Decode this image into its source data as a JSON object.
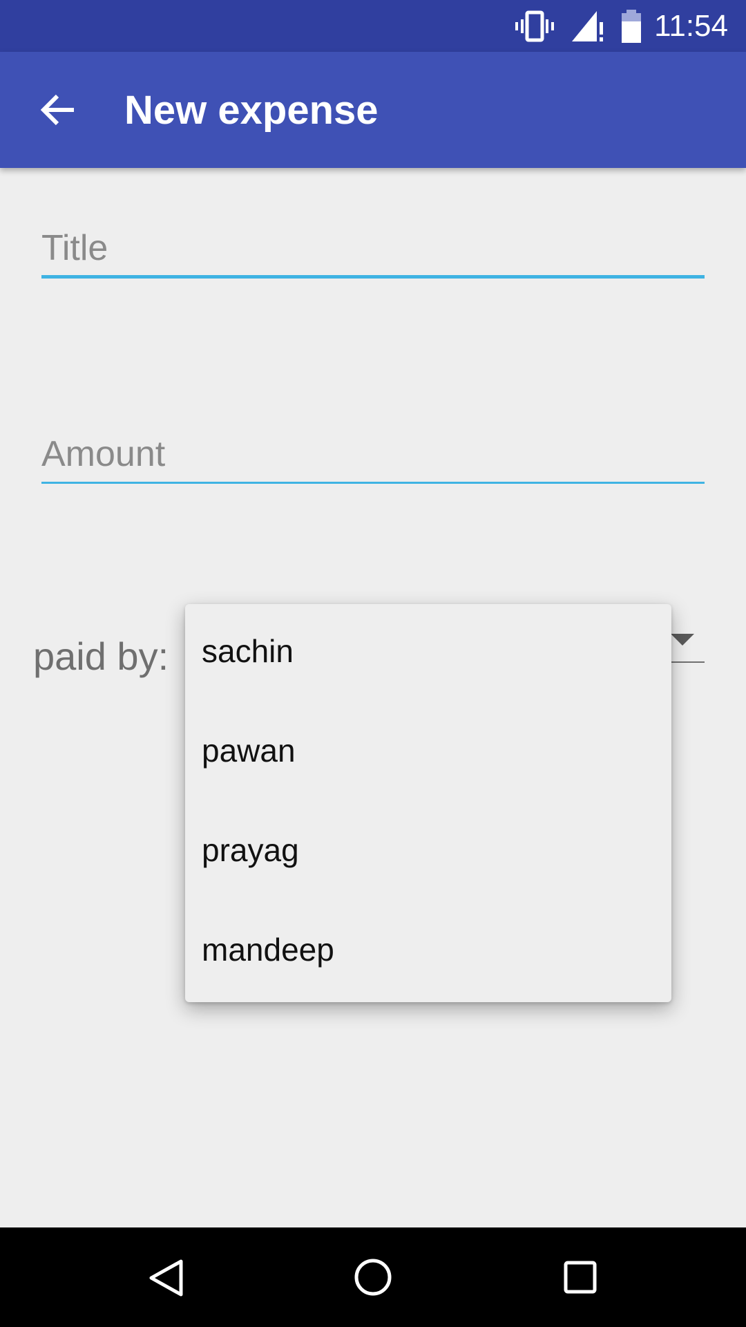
{
  "status_bar": {
    "time": "11:54",
    "icons": [
      "vibrate-icon",
      "signal-icon",
      "battery-icon"
    ]
  },
  "app_bar": {
    "title": "New expense",
    "back_icon": "arrow-back-icon",
    "color": "#3f51b5"
  },
  "form": {
    "title_placeholder": "Title",
    "amount_placeholder": "Amount",
    "paid_by_label": "paid by:"
  },
  "dropdown": {
    "options": [
      "sachin",
      "pawan",
      "prayag",
      "mandeep"
    ]
  },
  "nav_bar": {
    "icons": [
      "back-icon",
      "home-icon",
      "recents-icon"
    ]
  },
  "colors": {
    "status_bar": "#303f9f",
    "accent": "#3fb3e3",
    "background": "#eeeeee"
  }
}
